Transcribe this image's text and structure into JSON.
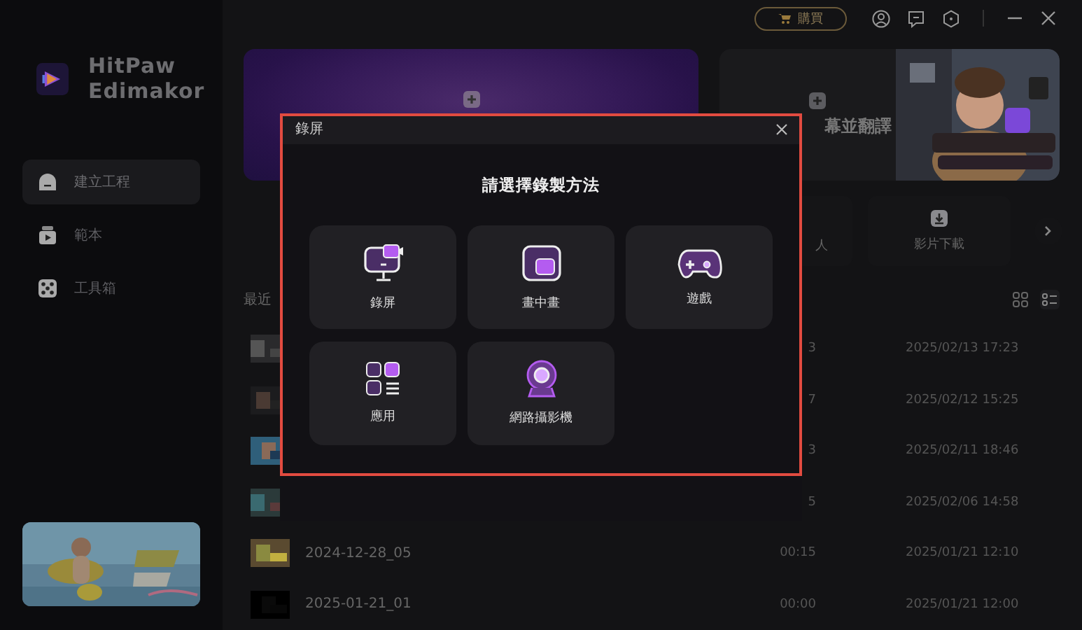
{
  "app": {
    "name": "HitPaw Edimakor"
  },
  "sidebar": {
    "items": [
      {
        "label": "建立工程",
        "selected": true
      },
      {
        "label": "範本",
        "selected": false
      },
      {
        "label": "工具箱",
        "selected": false
      }
    ]
  },
  "top_bar": {
    "buy_button": "購買"
  },
  "banners": [
    {
      "kind": "gradient"
    },
    {
      "label": "幕並翻譯"
    }
  ],
  "tools": [
    {
      "label": "人"
    },
    {
      "label": "影片下載"
    }
  ],
  "recent": {
    "title": "最近",
    "rows": [
      {
        "duration": "3",
        "date": "2025/02/13 17:23"
      },
      {
        "duration": "7",
        "date": "2025/02/12 15:25"
      },
      {
        "duration": "3",
        "date": "2025/02/11 18:46"
      },
      {
        "duration": "5",
        "date": "2025/02/06 14:58"
      },
      {
        "name": "2024-12-28_05",
        "duration": "00:15",
        "date": "2025/01/21 12:10"
      },
      {
        "name": "2025-01-21_01",
        "duration": "00:00",
        "date": "2025/01/21 12:00"
      }
    ]
  },
  "dialog": {
    "title": "錄屏",
    "heading": "請選擇錄製方法",
    "options": [
      {
        "label": "錄屏"
      },
      {
        "label": "畫中畫"
      },
      {
        "label": "遊戲"
      },
      {
        "label": "應用"
      },
      {
        "label": "網路攝影機"
      }
    ]
  }
}
